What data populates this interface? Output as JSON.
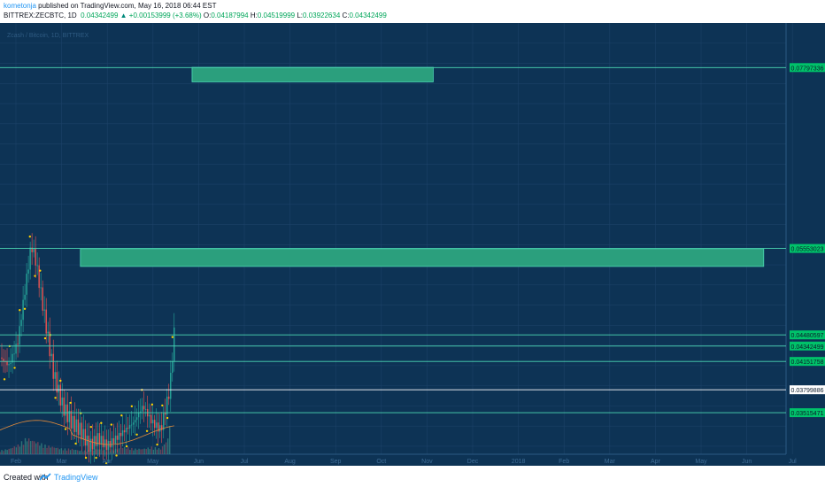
{
  "header": {
    "author": "kometonja",
    "published_text": "published on TradingView.com, May 16, 2018 06:44 EST",
    "symbol": "BITTREX:ZECBTC, 1D",
    "last": "0.04342499",
    "change": "+0.00153999 (+3.68%)",
    "o_label": "O:",
    "o_value": "0.04187994",
    "h_label": "H:",
    "h_value": "0.04519999",
    "l_label": "L:",
    "l_value": "0.03922634",
    "c_label": "C:",
    "c_value": "0.04342499"
  },
  "footer": {
    "created_with": "Created with",
    "brand": "TradingView"
  },
  "colors": {
    "background": "#0d3355",
    "grid": "#1c4268",
    "line": "#4dd8b4",
    "zone": "#2b9f7d",
    "label_green": "#00c26a",
    "label_white": "#ffffff",
    "candle_up": "#26a69a",
    "candle_down": "#ef5350",
    "signal": "#ffd200"
  },
  "chart_data": {
    "type": "candlestick",
    "symbol_label": "Zcash / Bitcoin, 1D, BITTREX",
    "y_axis_note": "faint tick labels along right axis",
    "ylim": [
      0.03,
      0.0835
    ],
    "x_tick_labels": [
      "Feb",
      "Mar",
      "Apr",
      "May",
      "Jun",
      "Jul",
      "Aug",
      "Sep",
      "Oct",
      "Nov",
      "Dec",
      "2018",
      "Feb",
      "Mar",
      "Apr",
      "May",
      "Jun",
      "Jul"
    ],
    "horizontal_levels": [
      {
        "value": 0.07797336,
        "label": "0.07797336",
        "style": "green"
      },
      {
        "value": 0.05553023,
        "label": "0.05553023",
        "style": "green"
      },
      {
        "value": 0.04480597,
        "label": "0.04480597",
        "style": "green"
      },
      {
        "value": 0.04342499,
        "label": "0.04342499",
        "style": "green"
      },
      {
        "value": 0.04151758,
        "label": "0.04151758",
        "style": "green"
      },
      {
        "value": 0.03799886,
        "label": "0.03799886",
        "style": "white"
      },
      {
        "value": 0.03515471,
        "label": "0.03515471",
        "style": "green"
      }
    ],
    "zones": [
      {
        "name": "upper-target-zone",
        "x_start": 21.5,
        "x_end": 48.5,
        "y_low": 0.0762,
        "y_high": 0.078
      },
      {
        "name": "middle-target-zone",
        "x_start": 9.0,
        "x_end": 85.5,
        "y_low": 0.0533,
        "y_high": 0.0555
      }
    ],
    "price_path": [
      [
        0,
        0.042
      ],
      [
        1,
        0.041
      ],
      [
        2,
        0.044
      ],
      [
        3,
        0.052
      ],
      [
        3.5,
        0.056
      ],
      [
        4,
        0.054
      ],
      [
        5,
        0.047
      ],
      [
        6,
        0.04
      ],
      [
        7,
        0.036
      ],
      [
        8,
        0.034
      ],
      [
        9,
        0.033
      ],
      [
        10,
        0.031
      ],
      [
        11,
        0.032
      ],
      [
        12,
        0.031
      ],
      [
        13,
        0.032
      ],
      [
        14,
        0.033
      ],
      [
        15,
        0.034
      ],
      [
        16,
        0.036
      ],
      [
        17,
        0.034
      ],
      [
        18,
        0.033
      ],
      [
        19,
        0.038
      ],
      [
        19.5,
        0.045
      ]
    ],
    "volume_profile": [
      0.2,
      0.3,
      0.5,
      0.9,
      0.7,
      0.5,
      0.4,
      0.3,
      0.3,
      0.2,
      0.2,
      0.3,
      0.2,
      0.3,
      0.4,
      0.3,
      0.3,
      0.4,
      0.3,
      1.0
    ]
  }
}
